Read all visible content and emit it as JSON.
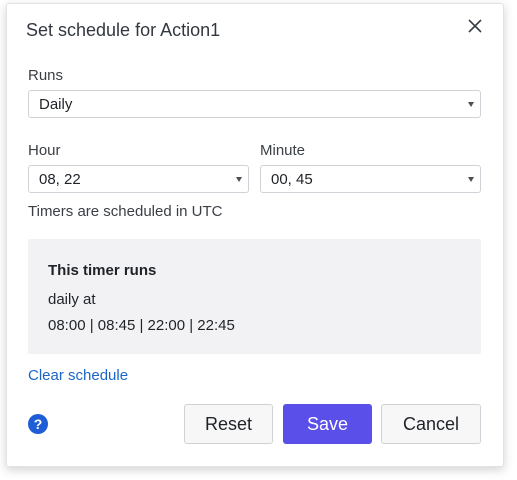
{
  "dialog": {
    "title": "Set schedule for Action1"
  },
  "runs": {
    "label": "Runs",
    "value": "Daily"
  },
  "hour": {
    "label": "Hour",
    "value": "08, 22"
  },
  "minute": {
    "label": "Minute",
    "value": "00, 45"
  },
  "timezone_note": "Timers are scheduled in UTC",
  "summary": {
    "heading": "This timer runs",
    "frequency": "daily at",
    "times": "08:00 | 08:45 | 22:00 | 22:45"
  },
  "clear_link": "Clear schedule",
  "help": {
    "glyph": "?"
  },
  "buttons": {
    "reset": "Reset",
    "save": "Save",
    "cancel": "Cancel"
  },
  "colors": {
    "primary": "#5a4fe8",
    "link": "#1d64c9",
    "help": "#1e5dd6",
    "summary_bg": "#f2f2f4"
  },
  "icons": {
    "close": "close-icon",
    "dropdown": "chevron-down-icon",
    "help": "help-icon"
  }
}
